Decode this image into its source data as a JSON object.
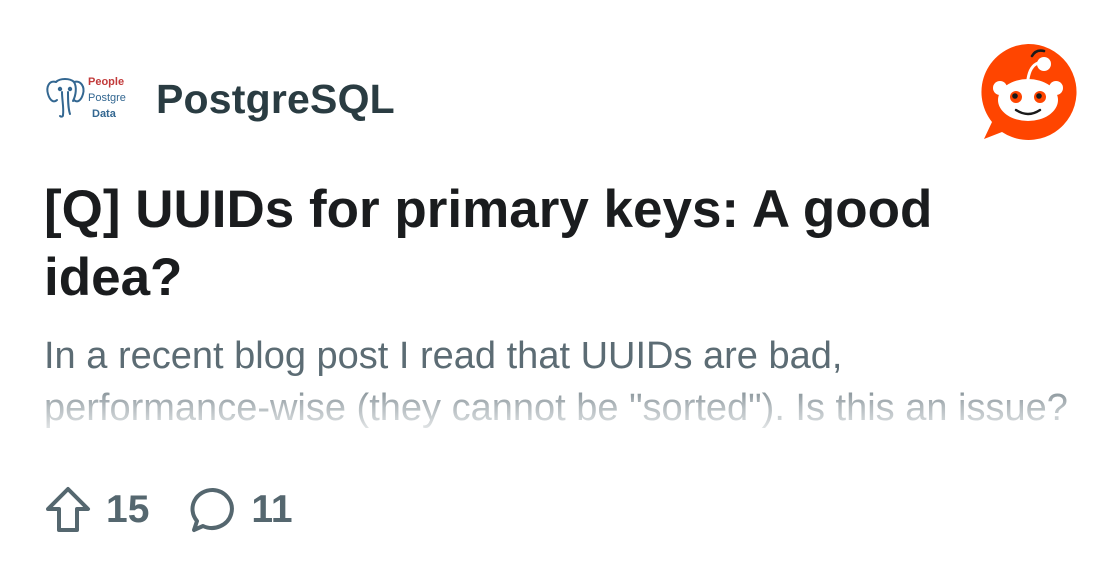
{
  "subreddit": {
    "name": "PostgreSQL",
    "icon": "postgresql-elephant-icon",
    "icon_text": [
      "People",
      "Postgre",
      "Data"
    ]
  },
  "post": {
    "title": "[Q] UUIDs for primary keys: A good idea?",
    "body": "In a recent blog post I read that UUIDs are bad, performance-wise (they cannot be \"sorted\"). Is this an issue?"
  },
  "stats": {
    "upvotes": "15",
    "comments": "11",
    "upvote_icon": "upvote-arrow-icon",
    "comment_icon": "comment-bubble-icon"
  },
  "branding": {
    "logo": "reddit-snoo-icon",
    "accent": "#ff4500"
  }
}
